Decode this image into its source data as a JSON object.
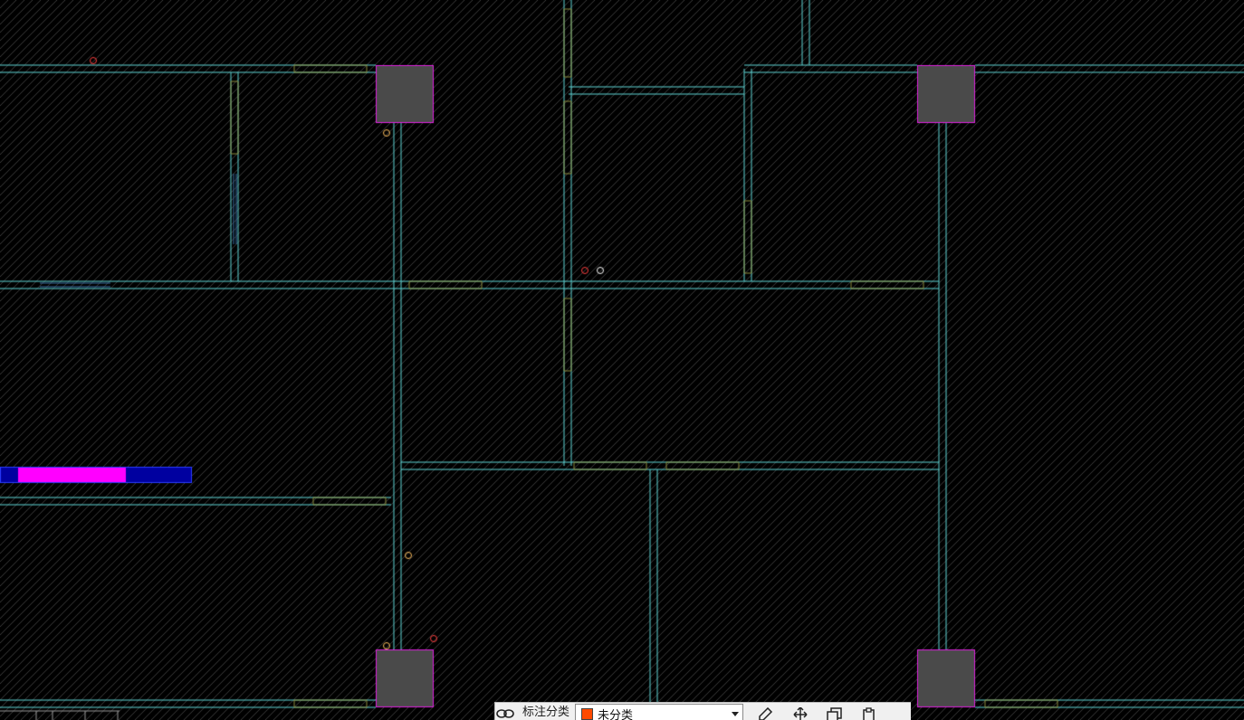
{
  "canvas": {
    "background": "#000000",
    "hatch_color": "#3c3c3c",
    "wall_color": "#5fd6d6",
    "door_color": "#8c8c3c",
    "window_color": "#3a6ea5",
    "column_fill": "#4a4a4a",
    "column_border": "#e020e0",
    "highlight_color": "#ff00ff",
    "highlight_bg": "#0000a0",
    "marker_colors": [
      "#ff4040",
      "#ffc060",
      "#ffffff"
    ]
  },
  "toolbar": {
    "label": "标注分类",
    "select_value": "未分类",
    "select_swatch_color": "#ff4a00",
    "icons": {
      "link": "link-icon",
      "edit": "edit-icon",
      "move": "move-icon",
      "copy": "copy-icon",
      "paste": "paste-icon"
    }
  }
}
